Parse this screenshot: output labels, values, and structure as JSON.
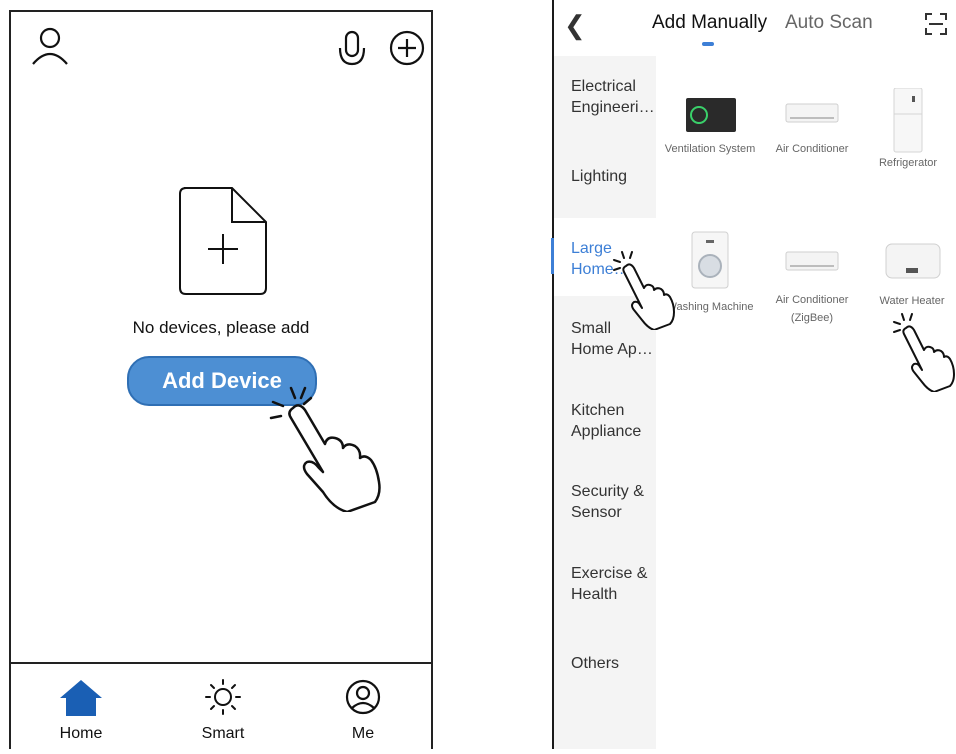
{
  "left_phone": {
    "empty_message": "No devices, please add",
    "add_device_label": "Add Device",
    "tabs": [
      {
        "label": "Home",
        "icon": "home-icon",
        "color": "#1a5fb4"
      },
      {
        "label": "Smart",
        "icon": "sun-icon"
      },
      {
        "label": "Me",
        "icon": "person-circle-icon"
      }
    ],
    "accent_color": "#4d8fd3"
  },
  "right_screen": {
    "tabs": {
      "manual": "Add Manually",
      "scan": "Auto Scan"
    },
    "active_tab": "Add Manually",
    "categories": [
      "Electrical Engineeri…",
      "Lighting",
      "Large Home…",
      "Small Home Ap…",
      "Kitchen Appliance",
      "Security & Sensor",
      "Exercise & Health",
      "Others"
    ],
    "active_category": "Large Home…",
    "devices": [
      {
        "label": "Ventilation System"
      },
      {
        "label": "Air Conditioner"
      },
      {
        "label": "Refrigerator"
      },
      {
        "label": "Washing Machine"
      },
      {
        "label": "Air Conditioner (ZigBee)"
      },
      {
        "label": "Water Heater"
      }
    ],
    "accent_color": "#3d7fd6"
  }
}
